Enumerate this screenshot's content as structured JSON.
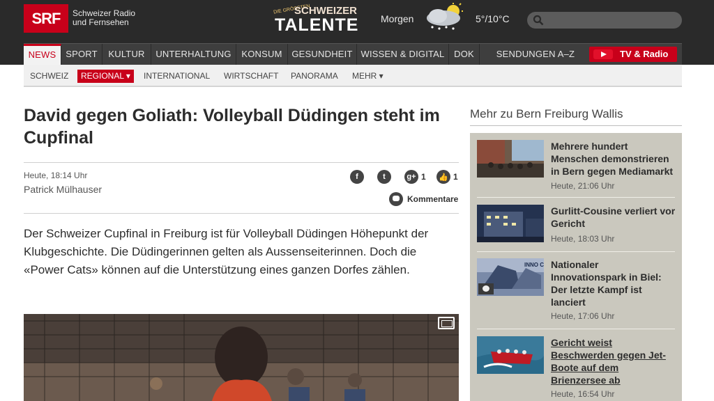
{
  "header": {
    "logo": "SRF",
    "logo_line1": "Schweizer Radio",
    "logo_line2": "und Fernsehen",
    "promo_small": "DIE GRÖSSTEN",
    "promo_line1": "SCHWEIZER",
    "promo_line2": "TALENTE",
    "weather_label": "Morgen",
    "weather_icon": "cloud-sun-snow-icon",
    "weather_temp": "5°/10°C",
    "search_placeholder": ""
  },
  "mainnav": {
    "items": [
      "NEWS",
      "SPORT",
      "KULTUR",
      "UNTERHALTUNG",
      "KONSUM",
      "GESUNDHEIT",
      "WISSEN & DIGITAL",
      "DOK",
      "SENDUNGEN A–Z"
    ],
    "tvradio": "TV & Radio"
  },
  "subnav": {
    "items": [
      "SCHWEIZ",
      "REGIONAL ▾",
      "INTERNATIONAL",
      "WIRTSCHAFT",
      "PANORAMA",
      "MEHR ▾"
    ]
  },
  "article": {
    "headline": "David gegen Goliath: Volleyball Düdingen steht im Cupfinal",
    "date": "Heute, 18:14 Uhr",
    "author": "Patrick Mülhauser",
    "share": {
      "googleplus_count": "1",
      "like_count": "1"
    },
    "comments_label": "Kommentare",
    "lead": "Der Schweizer Cupfinal in Freiburg ist für Volleyball Düdingen Höhepunkt der Klubgeschichte. Die Düdingerinnen gelten als Aussenseiterinnen. Doch die «Power Cats» können auf die Unterstützung eines ganzen Dorfes zählen."
  },
  "sidebar": {
    "title": "Mehr zu Bern Freiburg Wallis",
    "items": [
      {
        "title": "Mehrere hundert Menschen demonstrieren in Bern gegen Mediamarkt",
        "time": "Heute, 21:06 Uhr"
      },
      {
        "title": "Gurlitt-Cousine verliert vor Gericht",
        "time": "Heute, 18:03 Uhr"
      },
      {
        "title": "Nationaler Innovationspark in Biel: Der letzte Kampf ist lanciert",
        "time": "Heute, 17:06 Uhr",
        "thumb_caption": "INNO CAMPUS"
      },
      {
        "title": "Gericht weist Beschwerden gegen Jet-Boote auf dem Brienzersee ab",
        "time": "Heute, 16:54 Uhr"
      }
    ]
  },
  "colors": {
    "brand_red": "#c8001a",
    "header_bg": "#2a2a2a",
    "sidebar_bg": "#cac8be"
  }
}
